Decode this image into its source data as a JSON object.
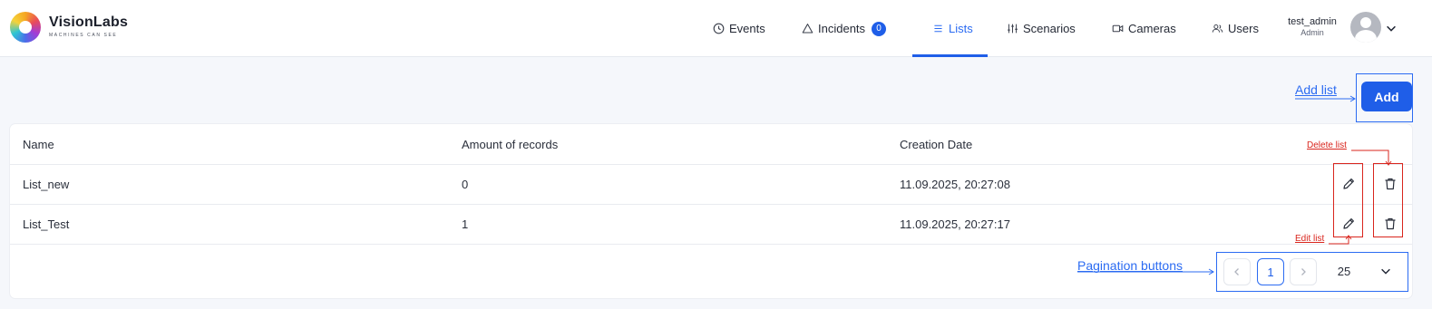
{
  "header": {
    "brand": "VisionLabs",
    "tagline": "MACHINES CAN SEE",
    "nav": {
      "events": "Events",
      "incidents": "Incidents",
      "incidents_count": "0",
      "lists": "Lists",
      "scenarios": "Scenarios",
      "cameras": "Cameras",
      "users": "Users"
    },
    "active_tab": "Lists",
    "user": {
      "name": "test_admin",
      "role": "Admin"
    }
  },
  "actions": {
    "add_label": "Add",
    "add_annotation": "Add list"
  },
  "table": {
    "columns": [
      "Name",
      "Amount of records",
      "Creation Date"
    ],
    "rows": [
      {
        "name": "List_new",
        "records": "0",
        "created": "11.09.2025, 20:27:08"
      },
      {
        "name": "List_Test",
        "records": "1",
        "created": "11.09.2025, 20:27:17"
      }
    ]
  },
  "annotations": {
    "delete_list": "Delete list",
    "edit_list": "Edit list",
    "pagination": "Pagination buttons"
  },
  "pagination": {
    "current_page": "1",
    "page_size": "25"
  },
  "colors": {
    "accent": "#1f5ee8",
    "annotation_blue": "#2b6bf2",
    "annotation_red": "#d9251d"
  }
}
